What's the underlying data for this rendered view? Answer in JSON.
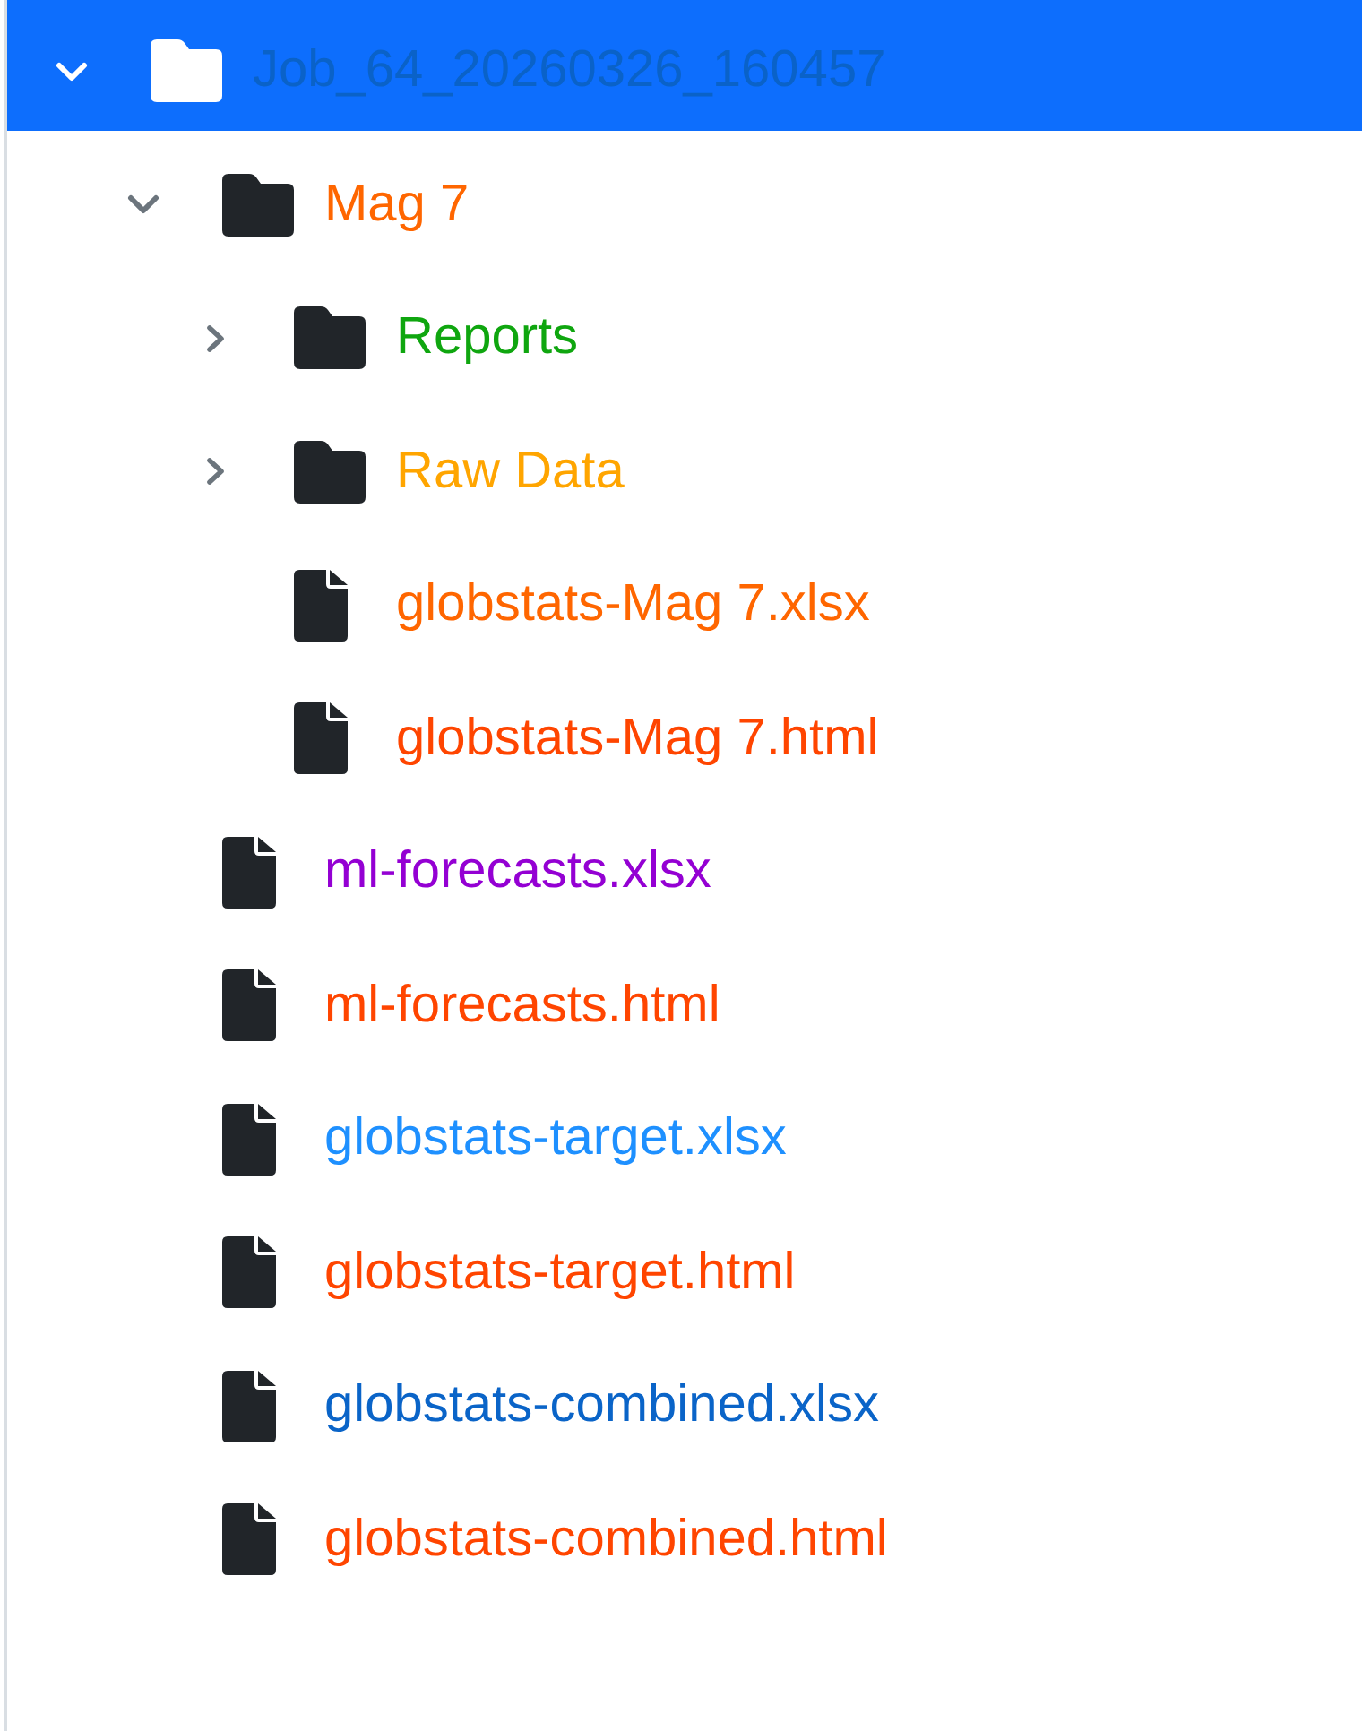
{
  "tree": {
    "items": [
      {
        "kind": "folder",
        "name": "Job_64_20260326_160457",
        "color": "#0a62c8",
        "selected": true,
        "expanded": true,
        "children": [
          {
            "kind": "folder",
            "name": "Mag 7",
            "color": "#ff6600",
            "selected": false,
            "expanded": true,
            "children": [
              {
                "kind": "folder",
                "name": "Reports",
                "color": "#0fa60f",
                "selected": false,
                "expanded": false
              },
              {
                "kind": "folder",
                "name": "Raw Data",
                "color": "#ffa500",
                "selected": false,
                "expanded": false
              },
              {
                "kind": "file",
                "name": "globstats-Mag 7.xlsx",
                "color": "#ff6600",
                "selected": false
              },
              {
                "kind": "file",
                "name": "globstats-Mag 7.html",
                "color": "#ff4500",
                "selected": false
              }
            ]
          },
          {
            "kind": "file",
            "name": "ml-forecasts.xlsx",
            "color": "#9400d3",
            "selected": false
          },
          {
            "kind": "file",
            "name": "ml-forecasts.html",
            "color": "#ff4500",
            "selected": false
          },
          {
            "kind": "file",
            "name": "globstats-target.xlsx",
            "color": "#1e90ff",
            "selected": false
          },
          {
            "kind": "file",
            "name": "globstats-target.html",
            "color": "#ff4500",
            "selected": false
          },
          {
            "kind": "file",
            "name": "globstats-combined.xlsx",
            "color": "#0a64c8",
            "selected": false
          },
          {
            "kind": "file",
            "name": "globstats-combined.html",
            "color": "#ff4500",
            "selected": false
          }
        ]
      }
    ]
  }
}
